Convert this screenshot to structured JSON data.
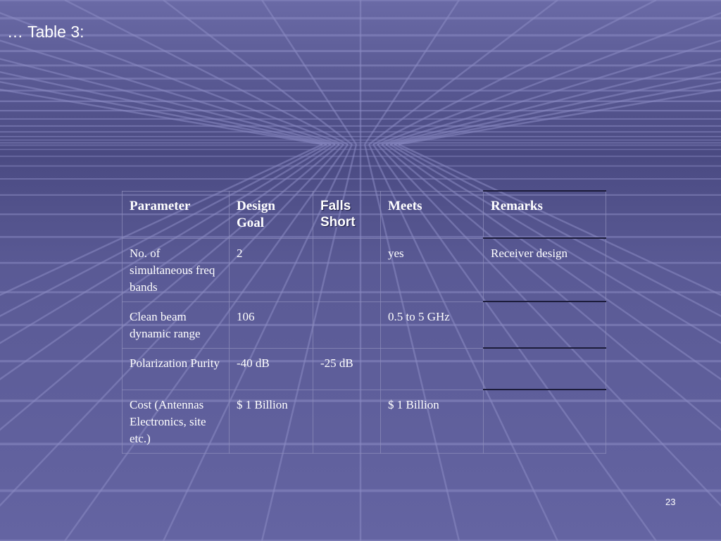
{
  "slide": {
    "title": "… Table 3:",
    "number": "23"
  },
  "table": {
    "headers": [
      "Parameter",
      "Design Goal",
      "Falls Short",
      "Meets",
      "Remarks"
    ],
    "rows": [
      [
        "No. of simultaneous freq bands",
        "2",
        "",
        "yes",
        "Receiver design"
      ],
      [
        "Clean beam dynamic range",
        "106",
        "",
        "0.5 to 5 GHz",
        ""
      ],
      [
        "Polarization Purity",
        "-40 dB",
        "-25 dB",
        "",
        ""
      ],
      [
        "Cost (Antennas Electronics, site etc.)",
        "$ 1 Billion",
        "",
        "$ 1 Billion",
        ""
      ]
    ]
  },
  "colors": {
    "background": "#5f5f9a",
    "grid_line": "#8686bd",
    "text": "#ffffff"
  }
}
